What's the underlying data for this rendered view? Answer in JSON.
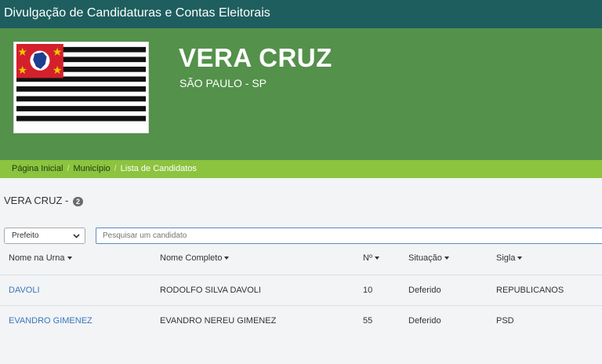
{
  "header": {
    "title": "Divulgação de Candidaturas e Contas Eleitorais"
  },
  "municipality": {
    "name": "VERA CRUZ",
    "state": "SÃO PAULO - SP"
  },
  "breadcrumb": {
    "items": [
      {
        "label": "Página Inicial"
      },
      {
        "label": "Município"
      },
      {
        "label": "Lista de Candidatos"
      }
    ],
    "separator": "/"
  },
  "list": {
    "title": "VERA CRUZ -",
    "count": "2"
  },
  "filter": {
    "cargo_selected": "Prefeito"
  },
  "search": {
    "placeholder": "Pesquisar um candidato"
  },
  "table": {
    "headers": [
      "Nome na Urna",
      "Nome Completo",
      "Nº",
      "Situação",
      "Sigla"
    ],
    "rows": [
      {
        "nome_urna": "DAVOLI",
        "nome_completo": "RODOLFO SILVA DAVOLI",
        "numero": "10",
        "situacao": "Deferido",
        "sigla": "REPUBLICANOS"
      },
      {
        "nome_urna": "EVANDRO GIMENEZ",
        "nome_completo": "EVANDRO NEREU GIMENEZ",
        "numero": "55",
        "situacao": "Deferido",
        "sigla": "PSD"
      }
    ]
  },
  "colors": {
    "topbar": "#1e5e5e",
    "hero": "#54914b",
    "breadcrumb": "#8cc33f",
    "link": "#3a77b8"
  },
  "flag_icon": "sao-paulo-state-flag"
}
